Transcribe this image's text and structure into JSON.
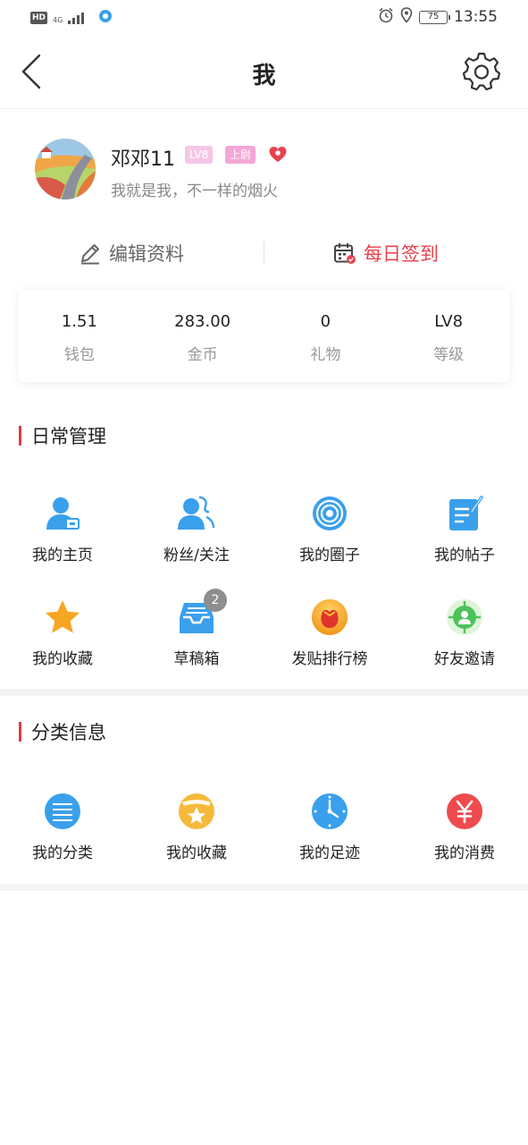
{
  "status_bar": {
    "hd": "HD",
    "network": "4G",
    "battery": "75",
    "time": "13:55"
  },
  "nav": {
    "title": "我"
  },
  "profile": {
    "name": "邓邓11",
    "level_badge": "LV8",
    "rank_badge": "上尉",
    "signature": "我就是我，不一样的烟火"
  },
  "actions": {
    "edit": "编辑资料",
    "signin": "每日签到"
  },
  "stats": [
    {
      "value": "1.51",
      "label": "钱包"
    },
    {
      "value": "283.00",
      "label": "金币"
    },
    {
      "value": "0",
      "label": "礼物"
    },
    {
      "value": "LV8",
      "label": "等级"
    }
  ],
  "daily": {
    "title": "日常管理",
    "items": [
      {
        "label": "我的主页",
        "icon": "homepage-icon"
      },
      {
        "label": "粉丝/关注",
        "icon": "fans-icon"
      },
      {
        "label": "我的圈子",
        "icon": "circle-icon"
      },
      {
        "label": "我的帖子",
        "icon": "posts-icon"
      },
      {
        "label": "我的收藏",
        "icon": "star-icon"
      },
      {
        "label": "草稿箱",
        "icon": "drafts-icon",
        "badge": "2"
      },
      {
        "label": "发贴排行榜",
        "icon": "ranking-icon"
      },
      {
        "label": "好友邀请",
        "icon": "invite-icon"
      }
    ]
  },
  "category": {
    "title": "分类信息",
    "items": [
      {
        "label": "我的分类",
        "icon": "list-icon"
      },
      {
        "label": "我的收藏",
        "icon": "favorites-icon"
      },
      {
        "label": "我的足迹",
        "icon": "clock-icon"
      },
      {
        "label": "我的消费",
        "icon": "yuan-icon"
      }
    ]
  },
  "colors": {
    "accent": "#e23b45",
    "blue": "#3aa0ec",
    "orange": "#f6a623"
  }
}
